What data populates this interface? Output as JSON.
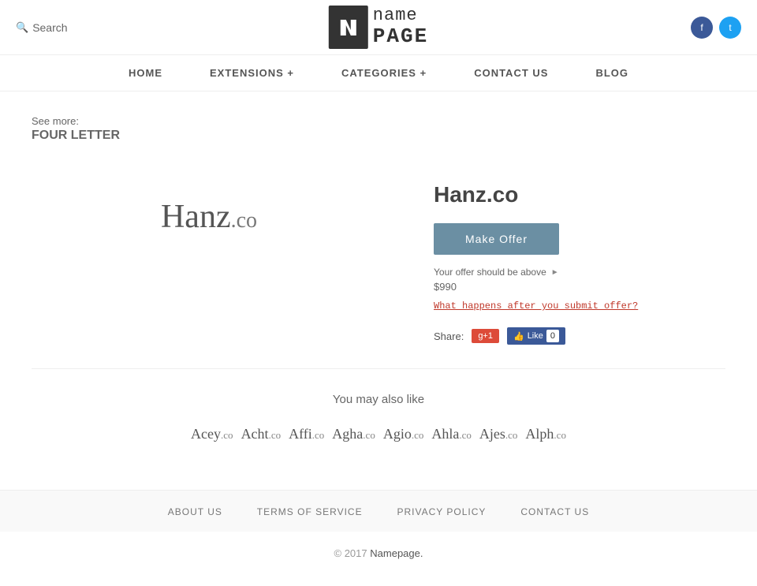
{
  "header": {
    "search_label": "Search",
    "logo_icon_char": "u",
    "logo_name": "name",
    "logo_page": "PAGE",
    "facebook_url": "#",
    "twitter_url": "#"
  },
  "nav": {
    "items": [
      {
        "label": "HOME",
        "id": "home"
      },
      {
        "label": "EXTENSIONS +",
        "id": "extensions"
      },
      {
        "label": "CATEGORIES +",
        "id": "categories"
      },
      {
        "label": "CONTACT US",
        "id": "contact"
      },
      {
        "label": "BLOG",
        "id": "blog"
      }
    ]
  },
  "breadcrumb": {
    "prefix": "See more:",
    "link_label": "FOUR LETTER"
  },
  "domain": {
    "display_name": "Hanz",
    "tld": ".co",
    "full_name": "Hanz.co",
    "make_offer_label": "Make Offer",
    "offer_hint": "Your offer should be above",
    "offer_price": "$990",
    "what_happens_label": "What happens after you submit offer?",
    "share_label": "Share:",
    "gplus_label": "g+1",
    "fb_like_label": "Like",
    "fb_count": "0"
  },
  "also_like": {
    "title": "You may also like",
    "items": [
      {
        "name": "Acey",
        "tld": ".co"
      },
      {
        "name": "Acht",
        "tld": ".co"
      },
      {
        "name": "Affi",
        "tld": ".co"
      },
      {
        "name": "Agha",
        "tld": ".co"
      },
      {
        "name": "Agio",
        "tld": ".co"
      },
      {
        "name": "Ahla",
        "tld": ".co"
      },
      {
        "name": "Ajes",
        "tld": ".co"
      },
      {
        "name": "Alph",
        "tld": ".co"
      }
    ]
  },
  "footer": {
    "links": [
      {
        "label": "ABOUT US",
        "id": "about"
      },
      {
        "label": "TERMS OF SERVICE",
        "id": "terms"
      },
      {
        "label": "PRIVACY POLICY",
        "id": "privacy"
      },
      {
        "label": "CONTACT US",
        "id": "contact"
      }
    ],
    "copyright": "© 2017",
    "brand_link": "Namepage."
  }
}
